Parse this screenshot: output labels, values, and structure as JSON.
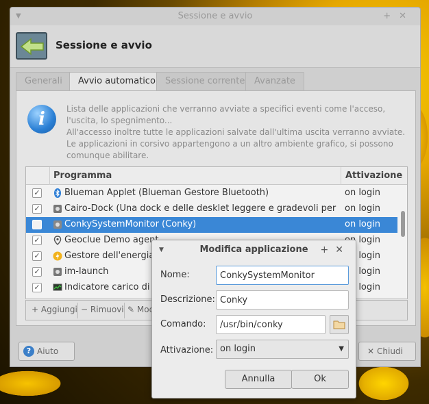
{
  "window": {
    "title": "Sessione e avvio",
    "header_title": "Sessione e avvio"
  },
  "tabs": [
    {
      "label": "Generali"
    },
    {
      "label": "Avvio automatico"
    },
    {
      "label": "Sessione corrente"
    },
    {
      "label": "Avanzate"
    }
  ],
  "info": {
    "line1": "Lista delle applicazioni che verranno avviate a specifici eventi come l'acceso, l'uscita, lo spegnimento...",
    "line2": "All'accesso inoltre tutte le applicazioni salvate dall'ultima uscita verranno avviate.",
    "line3": "Le applicazioni in corsivo appartengono a un altro ambiente grafico, si possono comunque abilitare."
  },
  "table": {
    "columns": {
      "program": "Programma",
      "activation": "Attivazione"
    },
    "rows": [
      {
        "name": "Blueman Applet (Blueman Gestore Bluetooth)",
        "activation": "on login",
        "checked": true,
        "icon": "bluetooth-icon"
      },
      {
        "name": "Cairo-Dock (Una dock e delle desklet leggere e gradevoli per il tuo des...",
        "activation": "on login",
        "checked": true,
        "icon": "gear-icon"
      },
      {
        "name": "ConkySystemMonitor (Conky)",
        "activation": "on login",
        "checked": false,
        "icon": "gear-icon"
      },
      {
        "name": "Geoclue Demo agent",
        "activation": "on login",
        "checked": true,
        "icon": "location-pin-icon"
      },
      {
        "name": "Gestore dell'energia (G",
        "activation": "on login",
        "checked": true,
        "icon": "power-icon"
      },
      {
        "name": "im-launch",
        "activation": "on login",
        "checked": true,
        "icon": "gear-icon"
      },
      {
        "name": "Indicatore carico di sist",
        "activation": "on login",
        "checked": true,
        "icon": "monitor-icon"
      }
    ]
  },
  "toolbar": {
    "add_label": "Aggiungi",
    "remove_label": "Rimuovi",
    "edit_label": "Mod"
  },
  "footer": {
    "help_label": "Aiuto",
    "close_label": "Chiudi"
  },
  "dialog": {
    "title": "Modifica applicazione",
    "name_label": "Nome:",
    "name_value": "ConkySystemMonitor",
    "desc_label": "Descrizione:",
    "desc_value": "Conky",
    "cmd_label": "Comando:",
    "cmd_value": "/usr/bin/conky",
    "activation_label": "Attivazione:",
    "activation_value": "on login",
    "cancel_label": "Annulla",
    "ok_label": "Ok"
  },
  "colors": {
    "selection": "#3a87d6",
    "info_icon": "#2a7fd4"
  }
}
